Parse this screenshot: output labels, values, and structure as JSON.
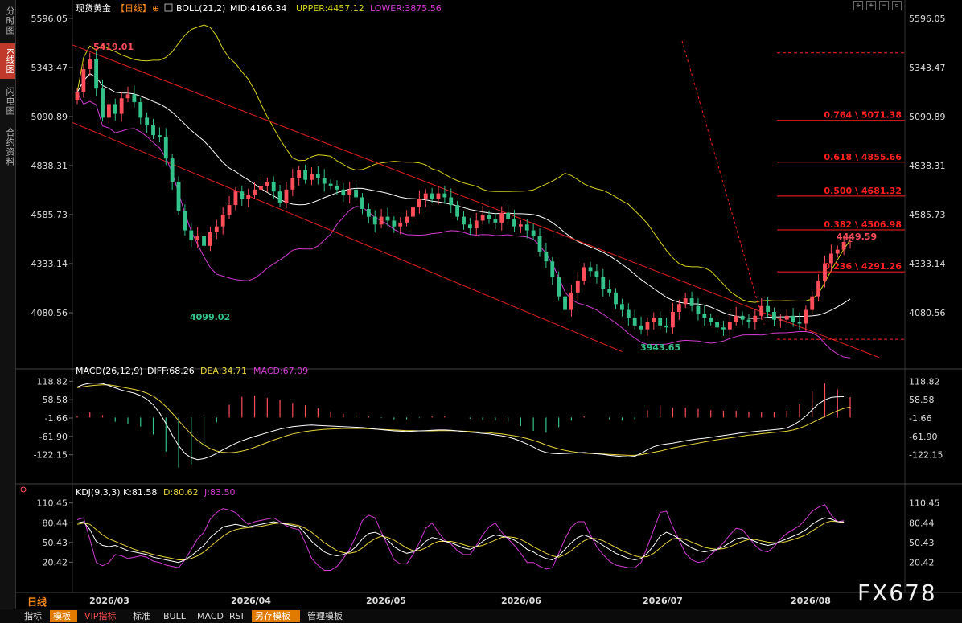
{
  "sidebar": {
    "tabs": [
      {
        "label": "分时图",
        "active": false
      },
      {
        "label": "K线图",
        "active": true
      },
      {
        "label": "闪电图",
        "active": false
      },
      {
        "label": "合约资料",
        "active": false
      }
    ]
  },
  "header": {
    "instrument": "现货黄金",
    "period": "【日线】",
    "indicator": "BOLL(21,2)",
    "mid": "MID:4166.34",
    "upper": "UPPER:4457.12",
    "lower": "LOWER:3875.56"
  },
  "macd_header": {
    "name": "MACD(26,12,9)",
    "diff": "DIFF:68.26",
    "dea": "DEA:34.71",
    "macd": "MACD:67.09"
  },
  "kdj_header": {
    "name": "KDJ(9,3,3)",
    "k": "K:81.58",
    "d": "D:80.62",
    "j": "J:83.50"
  },
  "colors": {
    "up": "#ff4d5a",
    "down": "#33c28a",
    "mid": "#ffffff",
    "upper": "#d6d21a",
    "lower": "#d23ad2",
    "channel": "#e0201c",
    "fib": "#ff2020",
    "diff": "#ffffff",
    "dea": "#e8d33a",
    "j": "#d23ad2"
  },
  "chart_data": {
    "type": "candlestick",
    "price_axis": {
      "ticks": [
        "5596.05",
        "5343.47",
        "5090.89",
        "4838.31",
        "4585.73",
        "4333.14",
        "4080.56"
      ],
      "range": [
        3820,
        5600
      ]
    },
    "macd_axis": {
      "ticks": [
        "118.82",
        "58.58",
        "-1.66",
        "-61.90",
        "-122.15"
      ],
      "range": [
        -160,
        125
      ]
    },
    "kdj_axis": {
      "ticks": [
        "110.45",
        "80.44",
        "50.43",
        "20.42"
      ],
      "range": [
        5,
        115
      ]
    },
    "x_labels": [
      "2026/03",
      "2026/04",
      "2026/05",
      "2026/06",
      "2026/07",
      "2026/08"
    ],
    "annotations": {
      "high": "5419.01",
      "low1": "4099.02",
      "low2": "3943.65",
      "last": "4449.59"
    },
    "fib_levels": [
      {
        "label": "0.764 \\ 5071.38",
        "value": 5071.38
      },
      {
        "label": "0.618 \\ 4855.66",
        "value": 4855.66
      },
      {
        "label": "0.500 \\ 4681.32",
        "value": 4681.32
      },
      {
        "label": "0.382 \\ 4506.98",
        "value": 4506.98
      },
      {
        "label": "0.236 \\ 4291.26",
        "value": 4291.26
      }
    ],
    "fib_range": {
      "high": 5419.01,
      "low": 3943.65
    },
    "closes": [
      5215,
      5335,
      5385,
      5235,
      5085,
      5155,
      5105,
      5185,
      5205,
      5165,
      5085,
      5045,
      4995,
      4985,
      4875,
      4755,
      4605,
      4505,
      4455,
      4475,
      4425,
      4495,
      4525,
      4585,
      4635,
      4705,
      4665,
      4685,
      4715,
      4735,
      4755,
      4705,
      4645,
      4715,
      4775,
      4815,
      4765,
      4795,
      4775,
      4745,
      4735,
      4715,
      4685,
      4715,
      4675,
      4615,
      4575,
      4535,
      4575,
      4555,
      4525,
      4545,
      4575,
      4625,
      4665,
      4695,
      4665,
      4695,
      4675,
      4635,
      4575,
      4535,
      4515,
      4555,
      4585,
      4565,
      4545,
      4595,
      4565,
      4525,
      4535,
      4505,
      4475,
      4395,
      4345,
      4265,
      4165,
      4095,
      4185,
      4245,
      4315,
      4295,
      4265,
      4205,
      4185,
      4125,
      4095,
      4055,
      4015,
      3995,
      4035,
      4055,
      4015,
      4005,
      4085,
      4125,
      4155,
      4115,
      4075,
      4055,
      4035,
      4005,
      3995,
      4035,
      4065,
      4045,
      4035,
      4065,
      4115,
      4085,
      4045,
      4045,
      4065,
      4035,
      4025,
      4095,
      4165,
      4245,
      4335,
      4385,
      4405,
      4445,
      4449.59
    ],
    "diff": [
      100,
      108,
      112,
      113,
      111,
      105,
      97,
      90,
      85,
      80,
      72,
      60,
      42,
      15,
      -20,
      -58,
      -92,
      -118,
      -132,
      -138,
      -135,
      -128,
      -118,
      -106,
      -95,
      -85,
      -76,
      -69,
      -62,
      -56,
      -50,
      -44,
      -38,
      -34,
      -30,
      -28,
      -26,
      -25,
      -26,
      -27,
      -28,
      -29,
      -30,
      -31,
      -32,
      -33,
      -35,
      -38,
      -40,
      -42,
      -44,
      -45,
      -46,
      -45,
      -44,
      -43,
      -42,
      -41,
      -41,
      -42,
      -44,
      -46,
      -48,
      -50,
      -52,
      -54,
      -57,
      -60,
      -64,
      -70,
      -78,
      -87,
      -97,
      -108,
      -115,
      -118,
      -119,
      -118,
      -117,
      -116,
      -115,
      -117,
      -119,
      -121,
      -124,
      -126,
      -128,
      -129,
      -127,
      -118,
      -106,
      -96,
      -90,
      -87,
      -84,
      -80,
      -76,
      -73,
      -70,
      -68,
      -65,
      -62,
      -59,
      -56,
      -53,
      -50,
      -48,
      -46,
      -44,
      -42,
      -40,
      -38,
      -34,
      -25,
      -12,
      5,
      25,
      45,
      58,
      66,
      68,
      68.26
    ],
    "dea": [
      98,
      101,
      104,
      106,
      107,
      107,
      104,
      100,
      96,
      92,
      87,
      80,
      70,
      55,
      36,
      14,
      -10,
      -33,
      -55,
      -75,
      -90,
      -102,
      -110,
      -114,
      -116,
      -114,
      -110,
      -105,
      -98,
      -90,
      -82,
      -74,
      -67,
      -60,
      -54,
      -50,
      -46,
      -43,
      -41,
      -39,
      -38,
      -37,
      -36,
      -36,
      -36,
      -36,
      -37,
      -38,
      -39,
      -40,
      -41,
      -42,
      -43,
      -43,
      -44,
      -44,
      -44,
      -43,
      -43,
      -43,
      -44,
      -45,
      -46,
      -47,
      -48,
      -50,
      -52,
      -54,
      -57,
      -60,
      -64,
      -69,
      -75,
      -82,
      -90,
      -97,
      -103,
      -108,
      -112,
      -115,
      -117,
      -118,
      -119,
      -120,
      -121,
      -122,
      -123,
      -124,
      -124,
      -122,
      -118,
      -114,
      -110,
      -105,
      -100,
      -96,
      -92,
      -88,
      -84,
      -80,
      -77,
      -73,
      -70,
      -67,
      -64,
      -61,
      -58,
      -56,
      -53,
      -51,
      -49,
      -47,
      -45,
      -41,
      -35,
      -27,
      -17,
      -7,
      3,
      13,
      22,
      30,
      34.71
    ],
    "macd": [
      5,
      15,
      17,
      14,
      8,
      -4,
      -14,
      -20,
      -22,
      -24,
      -30,
      -40,
      -56,
      -80,
      -112,
      -144,
      -164,
      -170,
      -154,
      -126,
      -90,
      -52,
      -16,
      16,
      42,
      58,
      68,
      72,
      72,
      68,
      64,
      60,
      58,
      52,
      48,
      44,
      40,
      36,
      30,
      24,
      20,
      16,
      12,
      10,
      8,
      6,
      4,
      0,
      -2,
      -4,
      -6,
      -6,
      -6,
      -4,
      -2,
      2,
      4,
      4,
      4,
      2,
      0,
      -2,
      -4,
      -6,
      -8,
      -8,
      -10,
      -12,
      -14,
      -20,
      -28,
      -36,
      -44,
      -52,
      -50,
      -42,
      -32,
      -20,
      -10,
      -2,
      4,
      2,
      0,
      -2,
      -6,
      -8,
      -10,
      -10,
      -6,
      8,
      24,
      36,
      40,
      36,
      32,
      32,
      32,
      30,
      28,
      24,
      24,
      22,
      22,
      22,
      22,
      22,
      20,
      20,
      18,
      18,
      18,
      18,
      22,
      32,
      44,
      64,
      84,
      104,
      112,
      110,
      92,
      76,
      67.09
    ],
    "k": [
      80,
      82,
      70,
      52,
      46,
      44,
      46,
      42,
      38,
      36,
      34,
      32,
      28,
      26,
      24,
      22,
      20,
      24,
      30,
      38,
      46,
      58,
      66,
      74,
      76,
      78,
      76,
      74,
      76,
      78,
      80,
      82,
      80,
      78,
      76,
      74,
      64,
      52,
      44,
      36,
      32,
      30,
      32,
      36,
      44,
      56,
      64,
      66,
      62,
      54,
      44,
      38,
      34,
      36,
      42,
      52,
      58,
      56,
      52,
      50,
      46,
      42,
      40,
      44,
      52,
      58,
      62,
      60,
      58,
      54,
      48,
      40,
      36,
      30,
      26,
      24,
      30,
      40,
      50,
      58,
      62,
      58,
      52,
      46,
      40,
      34,
      30,
      26,
      24,
      26,
      34,
      46,
      60,
      66,
      62,
      56,
      48,
      42,
      38,
      36,
      38,
      40,
      44,
      50,
      56,
      58,
      56,
      52,
      48,
      46,
      48,
      52,
      56,
      60,
      64,
      70,
      78,
      84,
      88,
      86,
      82,
      81.58
    ],
    "d": [
      78,
      80,
      78,
      70,
      62,
      56,
      52,
      48,
      44,
      40,
      37,
      35,
      32,
      30,
      28,
      26,
      24,
      24,
      26,
      30,
      36,
      44,
      52,
      60,
      66,
      70,
      72,
      73,
      74,
      75,
      77,
      79,
      80,
      79,
      78,
      76,
      72,
      66,
      58,
      50,
      44,
      38,
      35,
      34,
      36,
      42,
      50,
      56,
      60,
      58,
      54,
      48,
      42,
      38,
      38,
      42,
      48,
      52,
      52,
      52,
      50,
      47,
      44,
      44,
      46,
      50,
      54,
      58,
      59,
      58,
      55,
      50,
      44,
      39,
      34,
      30,
      28,
      32,
      38,
      46,
      53,
      57,
      56,
      53,
      48,
      43,
      38,
      34,
      30,
      28,
      29,
      34,
      42,
      50,
      56,
      57,
      55,
      51,
      47,
      43,
      41,
      40,
      41,
      44,
      48,
      52,
      55,
      55,
      53,
      51,
      50,
      50,
      52,
      55,
      58,
      62,
      68,
      74,
      80,
      83,
      82,
      80.62
    ],
    "j": [
      85,
      88,
      55,
      20,
      15,
      20,
      32,
      30,
      26,
      28,
      30,
      28,
      22,
      20,
      16,
      14,
      12,
      24,
      40,
      56,
      66,
      86,
      96,
      102,
      100,
      96,
      86,
      78,
      82,
      84,
      86,
      88,
      82,
      76,
      72,
      70,
      50,
      26,
      16,
      8,
      8,
      14,
      26,
      40,
      60,
      84,
      92,
      88,
      66,
      46,
      24,
      18,
      18,
      32,
      50,
      72,
      80,
      66,
      54,
      48,
      38,
      32,
      32,
      46,
      62,
      74,
      80,
      66,
      56,
      46,
      34,
      20,
      20,
      14,
      10,
      12,
      34,
      56,
      74,
      82,
      82,
      62,
      44,
      32,
      22,
      16,
      14,
      12,
      12,
      20,
      44,
      70,
      96,
      98,
      74,
      54,
      34,
      24,
      20,
      22,
      32,
      40,
      50,
      62,
      72,
      70,
      58,
      46,
      38,
      36,
      44,
      56,
      64,
      70,
      76,
      86,
      98,
      104,
      108,
      92,
      82,
      83.5
    ]
  },
  "footer": {
    "period_label": "日线",
    "tabs": [
      {
        "label": "指标",
        "style": "normal"
      },
      {
        "label": "模板",
        "style": "orange"
      },
      {
        "label": "VIP指标",
        "style": "vip"
      },
      {
        "label": "标准",
        "style": "normal"
      },
      {
        "label": "BULL",
        "style": "normal"
      },
      {
        "label": "MACD",
        "style": "normal"
      },
      {
        "label": "RSI",
        "style": "normal"
      },
      {
        "label": "另存模板",
        "style": "orange"
      },
      {
        "label": "管理模板",
        "style": "normal"
      }
    ]
  },
  "watermark": "FX678"
}
